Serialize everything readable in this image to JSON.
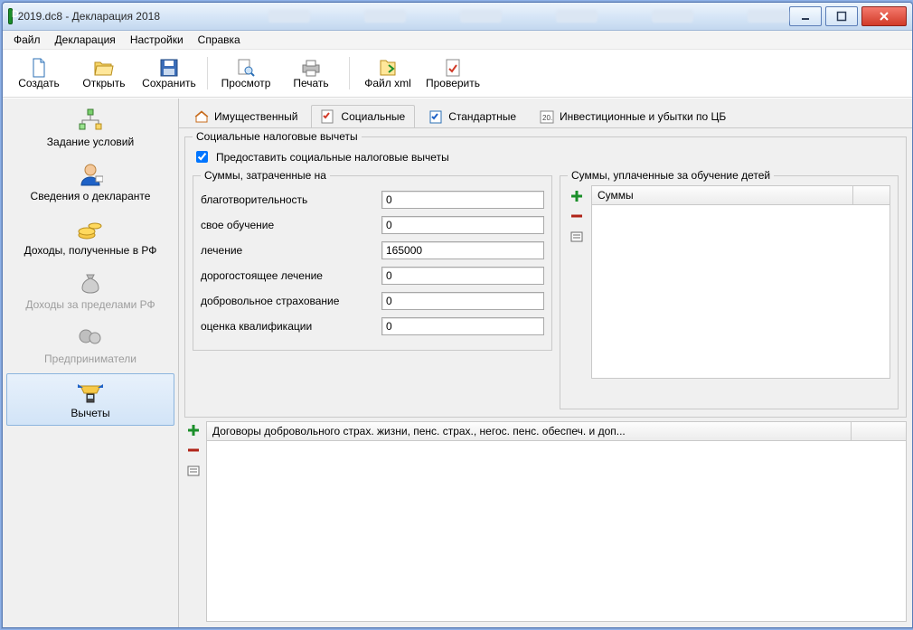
{
  "window": {
    "title": "2019.dc8 - Декларация 2018"
  },
  "menu": {
    "file": "Файл",
    "declaration": "Декларация",
    "settings": "Настройки",
    "help": "Справка"
  },
  "toolbar": {
    "create": "Создать",
    "open": "Открыть",
    "save": "Сохранить",
    "preview": "Просмотр",
    "print": "Печать",
    "file_xml": "Файл xml",
    "check": "Проверить"
  },
  "sidebar": {
    "items": [
      {
        "label": "Задание условий"
      },
      {
        "label": "Сведения о декларанте"
      },
      {
        "label": "Доходы, полученные в РФ"
      },
      {
        "label": "Доходы за пределами РФ"
      },
      {
        "label": "Предприниматели"
      },
      {
        "label": "Вычеты"
      }
    ]
  },
  "tabs": {
    "property": "Имущественный",
    "social": "Социальные",
    "standard": "Стандартные",
    "invest": "Инвестиционные и убытки по ЦБ"
  },
  "group": {
    "legend": "Социальные налоговые вычеты",
    "provide": "Предоставить социальные налоговые вычеты"
  },
  "left": {
    "legend": "Суммы, затраченные на",
    "charity_label": "благотворительность",
    "charity_value": "0",
    "own_edu_label": "свое обучение",
    "own_edu_value": "0",
    "treat_label": "лечение",
    "treat_value": "165000",
    "exp_treat_label": "дорогостоящее лечение",
    "exp_treat_value": "0",
    "vol_ins_label": "добровольное страхование",
    "vol_ins_value": "0",
    "qual_label": "оценка квалификации",
    "qual_value": "0"
  },
  "right": {
    "legend": "Суммы, уплаченные за обучение детей",
    "col1": "Суммы"
  },
  "bottom": {
    "col1": "Договоры добровольного страх. жизни, пенс. страх., негос. пенс. обеспеч. и доп..."
  }
}
